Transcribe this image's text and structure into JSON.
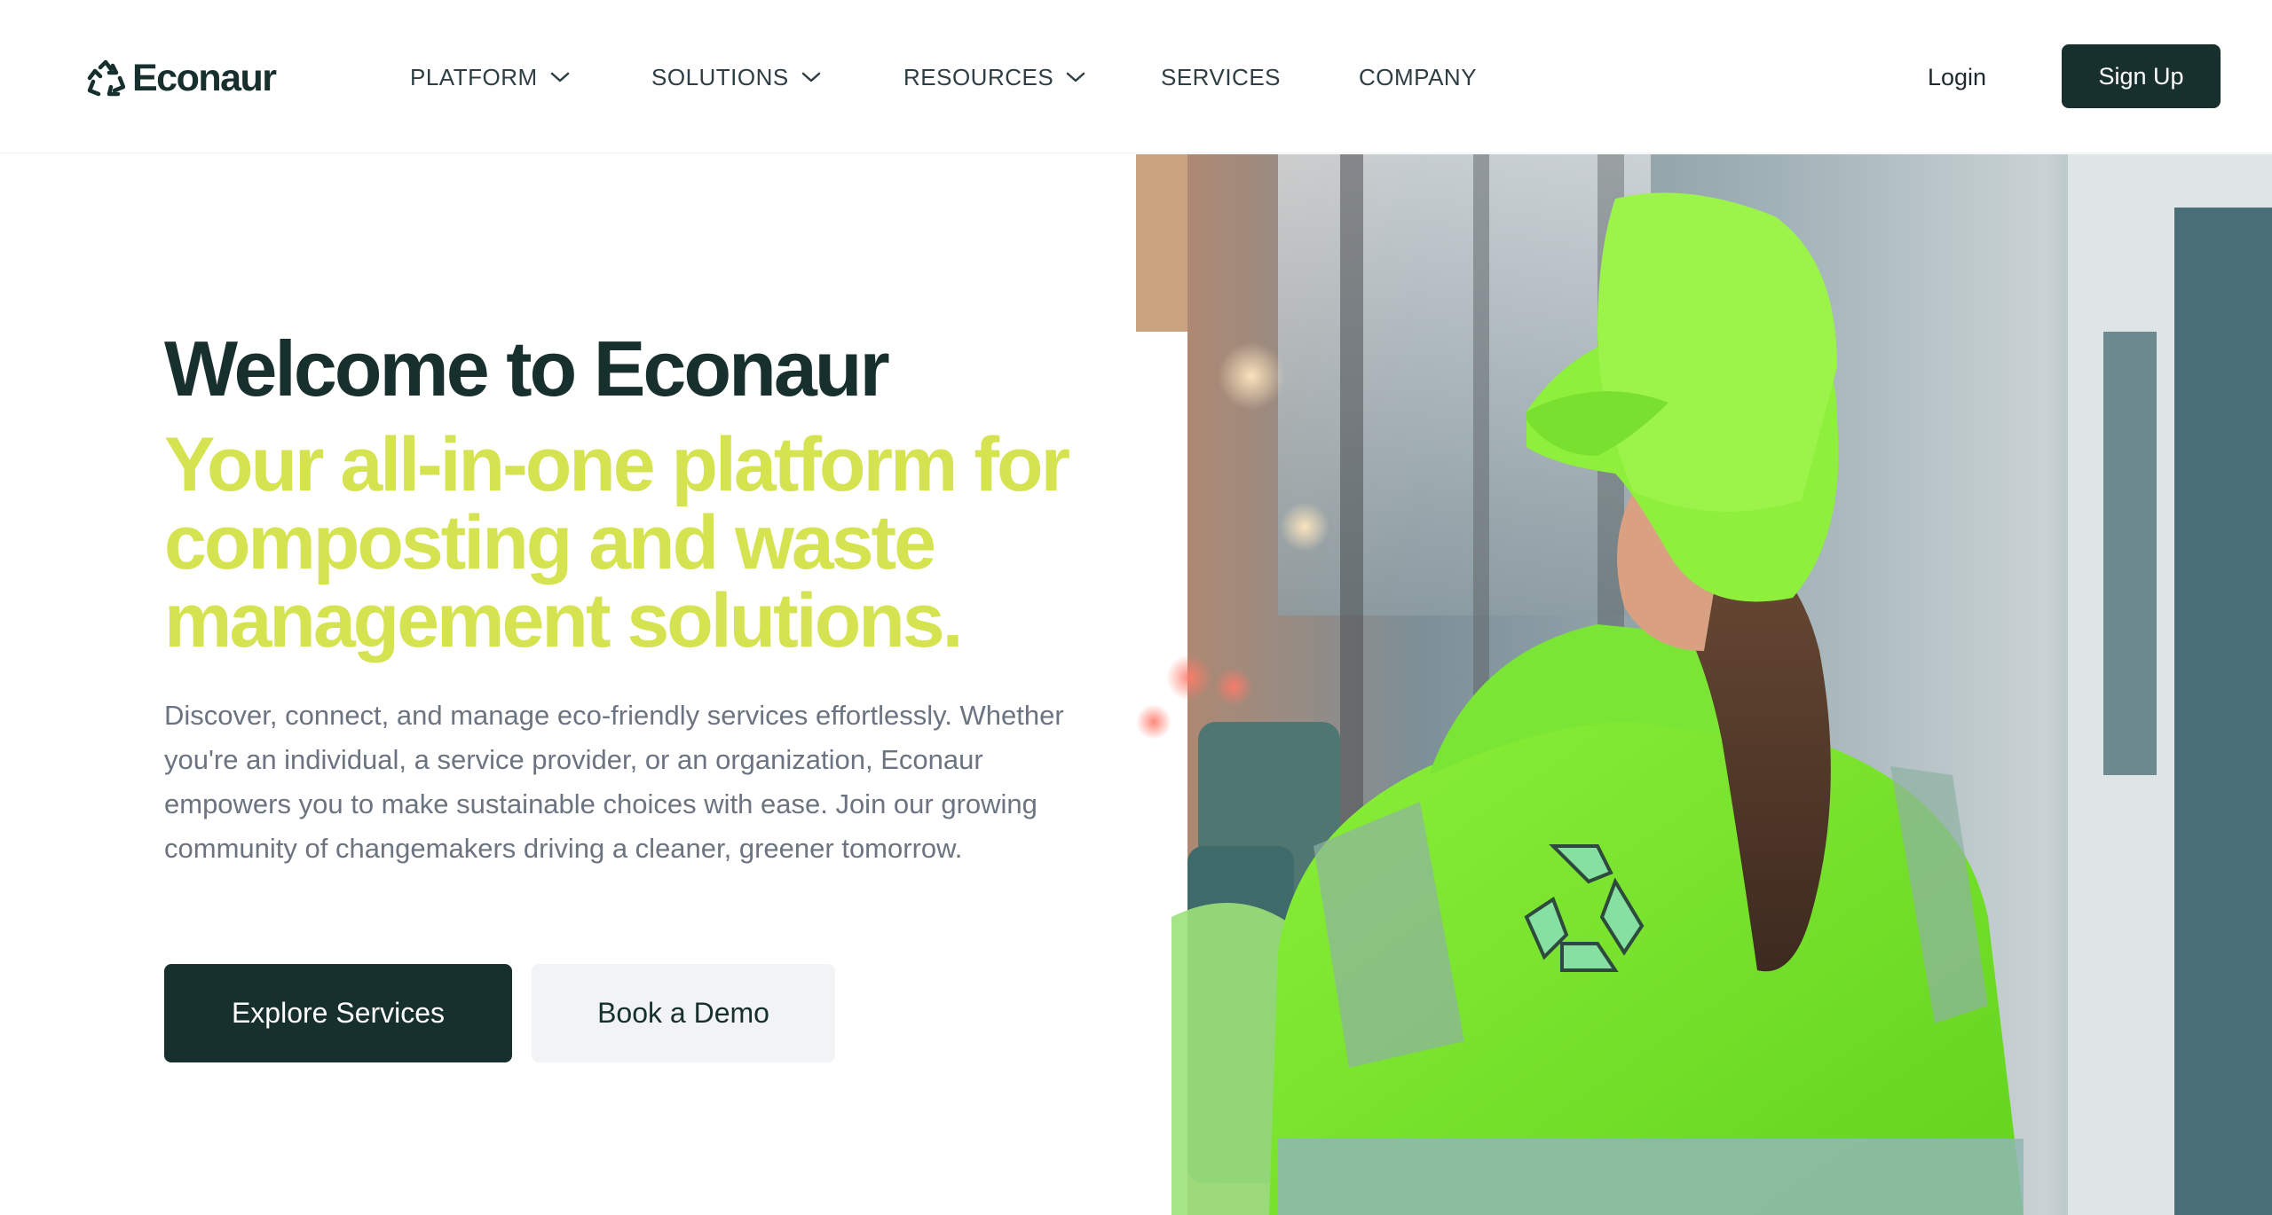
{
  "brand": {
    "name": "Econaur",
    "logo_icon": "recycle-icon",
    "color": "#18302d"
  },
  "nav": {
    "items": [
      {
        "label": "PLATFORM",
        "has_dropdown": true
      },
      {
        "label": "SOLUTIONS",
        "has_dropdown": true
      },
      {
        "label": "RESOURCES",
        "has_dropdown": true
      },
      {
        "label": "SERVICES",
        "has_dropdown": false
      },
      {
        "label": "COMPANY",
        "has_dropdown": false
      }
    ],
    "login_label": "Login",
    "signup_label": "Sign Up"
  },
  "hero": {
    "title": "Welcome to Econaur",
    "subtitle": "Your all-in-one platform for composting and waste management solutions.",
    "description": "Discover, connect, and manage eco-friendly services effortlessly. Whether you're an individual, a service provider, or an organization, Econaur empowers you to make sustainable choices with ease. Join our growing community of changemakers driving a cleaner, greener tomorrow.",
    "primary_cta": "Explore Services",
    "secondary_cta": "Book a Demo",
    "image_icon": "worker-photo-icon"
  },
  "colors": {
    "dark_green": "#18302d",
    "accent_lime": "#d6e350",
    "text_gray": "#6b7480",
    "button_light": "#f1f3f5"
  }
}
